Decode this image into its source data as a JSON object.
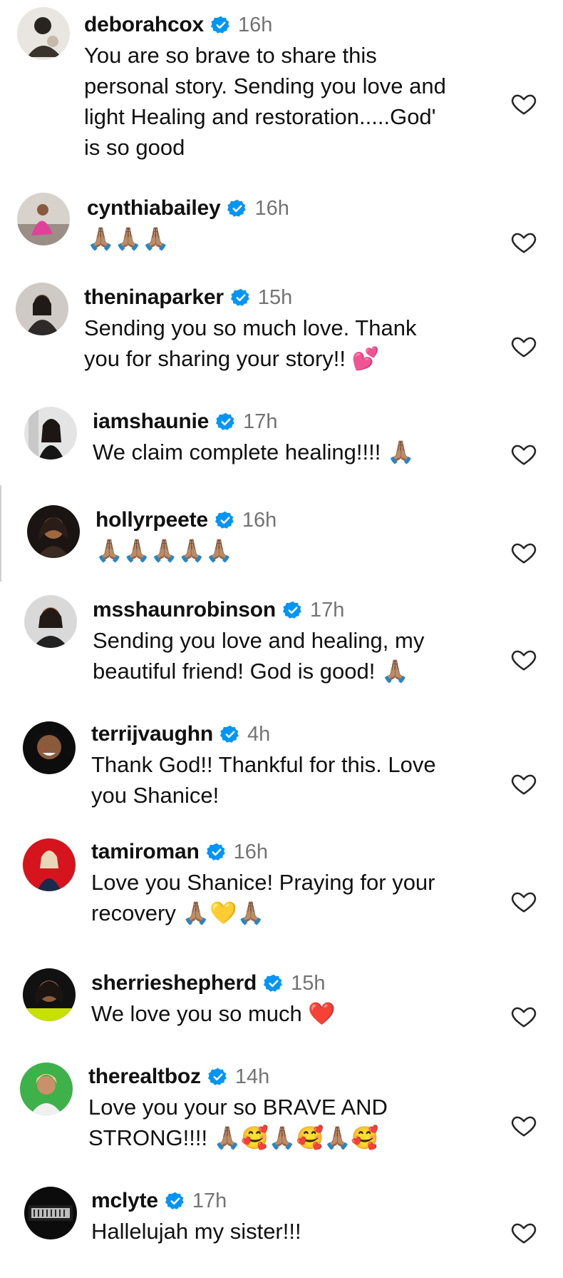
{
  "colors": {
    "verified": "#0095f6",
    "time": "#737373",
    "text": "#111111"
  },
  "comments": [
    {
      "username": "deborahcox",
      "time": "16h",
      "text": "You are so brave to share this\npersonal story. Sending you love and\nlight Healing and restoration.....God'\nis so good"
    },
    {
      "username": "cynthiabailey",
      "time": "16h",
      "text": "🙏🏽🙏🏽🙏🏽"
    },
    {
      "username": "theninaparker",
      "time": "15h",
      "text": "Sending you so much love. Thank\nyou for sharing your story!! 💕"
    },
    {
      "username": "iamshaunie",
      "time": "17h",
      "text": "We claim complete healing!!!! 🙏🏽"
    },
    {
      "username": "hollyrpeete",
      "time": "16h",
      "text": "🙏🏽🙏🏽🙏🏽🙏🏽🙏🏽"
    },
    {
      "username": "msshaunrobinson",
      "time": "17h",
      "text": "Sending you love and healing, my\nbeautiful friend! God is good! 🙏🏽"
    },
    {
      "username": "terrijvaughn",
      "time": "4h",
      "text": "Thank God!! Thankful for this. Love\nyou Shanice!"
    },
    {
      "username": "tamiroman",
      "time": "16h",
      "text": "Love you Shanice! Praying for your\nrecovery 🙏🏽💛🙏🏽"
    },
    {
      "username": "sherrieshepherd",
      "time": "15h",
      "text": "We love you so much ❤️"
    },
    {
      "username": "therealtboz",
      "time": "14h",
      "text": "Love you your so BRAVE AND\nSTRONG!!!! 🙏🏽🥰🙏🏽🥰🙏🏽🥰"
    },
    {
      "username": "mclyte",
      "time": "17h",
      "text": "Hallelujah my sister!!!"
    }
  ]
}
